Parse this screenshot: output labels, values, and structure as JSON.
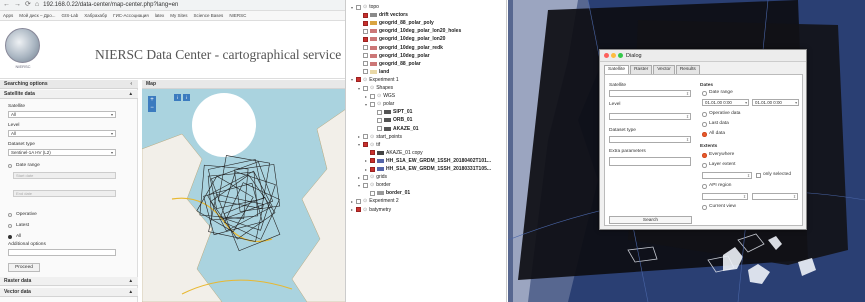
{
  "browser": {
    "url": "192.168.0.22/data-center/map-center.php?lang=en",
    "bookmarks": [
      "Apps",
      "Мой диск – Дро...",
      "GIS-Lab",
      "Хабрахабр",
      "ГИС-Ассоциация",
      "latex",
      "My Sites",
      "Science Bases",
      "NIERSC"
    ]
  },
  "site": {
    "title": "NIERSC Data Center - cartographical service",
    "logo_text": "NIERSC"
  },
  "search": {
    "header": "Searching options",
    "sections": {
      "satellite": "Satellite data",
      "raster": "Raster data",
      "vector": "Vector data"
    },
    "satellite_label": "Satellite",
    "satellite_value": "All",
    "level_label": "Level",
    "level_value": "All",
    "dataset_label": "Dataset type",
    "dataset_value": "Sentinel-1A HV (L2)",
    "date_range": "Date range",
    "start_ph": "Start date",
    "end_ph": "End date",
    "operative": "Operative",
    "latest": "Latest",
    "all": "All",
    "additional": "Additional options",
    "proceed": "Proceed"
  },
  "map": {
    "header": "Map"
  },
  "tree": {
    "items": [
      {
        "label": "topo",
        "level": 0,
        "expand": "▾",
        "checked": false,
        "group": true
      },
      {
        "label": "drift vectors",
        "level": 1,
        "checked": true,
        "bold": true,
        "sym": "#8a8a8a"
      },
      {
        "label": "geogrid_88_polar_poly",
        "level": 1,
        "checked": true,
        "bold": true,
        "sym": "#d9a441"
      },
      {
        "label": "geogrid_10deg_polar_lon20_holes",
        "level": 1,
        "checked": false,
        "bold": true,
        "sym": "#c77"
      },
      {
        "label": "geogrid_10deg_polar_lon20",
        "level": 1,
        "checked": true,
        "bold": true,
        "sym": "#c77"
      },
      {
        "label": "geogrid_10deg_polar_redk",
        "level": 1,
        "checked": false,
        "bold": true,
        "sym": "#c77"
      },
      {
        "label": "geogrid_10deg_polar",
        "level": 1,
        "checked": false,
        "bold": true,
        "sym": "#c77"
      },
      {
        "label": "geogrid_88_polar",
        "level": 1,
        "checked": false,
        "bold": true,
        "sym": "#c77"
      },
      {
        "label": "land",
        "level": 1,
        "checked": false,
        "bold": true,
        "sym": "#e9d8a6"
      },
      {
        "label": "Experiment 1",
        "level": 0,
        "expand": "▾",
        "checked": true,
        "group": true
      },
      {
        "label": "Shapes",
        "level": 1,
        "expand": "▾",
        "checked": false,
        "group": true
      },
      {
        "label": "WGS",
        "level": 2,
        "expand": "▸",
        "checked": false,
        "group": true
      },
      {
        "label": "polar",
        "level": 2,
        "expand": "▾",
        "checked": false,
        "group": true
      },
      {
        "label": "SIPT_01",
        "level": 3,
        "checked": false,
        "bold": true,
        "sym": "#555"
      },
      {
        "label": "ORB_01",
        "level": 3,
        "checked": false,
        "bold": true,
        "sym": "#555"
      },
      {
        "label": "AKAZE_01",
        "level": 3,
        "checked": false,
        "bold": true,
        "sym": "#555"
      },
      {
        "label": "start_points",
        "level": 1,
        "expand": "▸",
        "checked": false,
        "group": true
      },
      {
        "label": "tif",
        "level": 1,
        "expand": "▾",
        "checked": true,
        "group": true
      },
      {
        "label": "AKAZE_01 copy",
        "level": 2,
        "checked": true,
        "sym": "#444"
      },
      {
        "label": "HH_S1A_EW_GRDM_1SSH_20180402T101...",
        "level": 2,
        "expand": "▸",
        "checked": true,
        "bold": true,
        "sym": "#5566aa"
      },
      {
        "label": "HH_S1A_EW_GRDM_1SSH_20180331T105...",
        "level": 2,
        "expand": "▸",
        "checked": true,
        "bold": true,
        "sym": "#5566aa"
      },
      {
        "label": "grids",
        "level": 1,
        "expand": "▸",
        "checked": false,
        "group": true
      },
      {
        "label": "border",
        "level": 1,
        "expand": "▾",
        "checked": false,
        "group": true
      },
      {
        "label": "border_01",
        "level": 2,
        "checked": false,
        "bold": true,
        "sym": "#999"
      },
      {
        "label": "Experiment 2",
        "level": 0,
        "expand": "▸",
        "checked": false,
        "group": true
      },
      {
        "label": "batymetry",
        "level": 0,
        "expand": "▸",
        "checked": true,
        "group": true
      }
    ]
  },
  "dialog": {
    "title": "Dialog",
    "tabs": [
      "Satellite",
      "Raster",
      "Vector",
      "Results"
    ],
    "satellite_label": "Satellite",
    "level_label": "Level",
    "dataset_label": "Dataset type",
    "extra_label": "Extra parameters",
    "dates_label": "Dates",
    "date_range": "Date range",
    "date_from": "01.01.00 0:00",
    "date_to": "01.01.00 0:00",
    "operative": "Operative data",
    "last": "Last data",
    "all": "All data",
    "extents_label": "Extents",
    "everywhere": "Everywhere",
    "layer_extent": "Layer extent",
    "only_selected": "only selected",
    "api_region": "API region",
    "current_view": "Current view",
    "search": "Search"
  }
}
